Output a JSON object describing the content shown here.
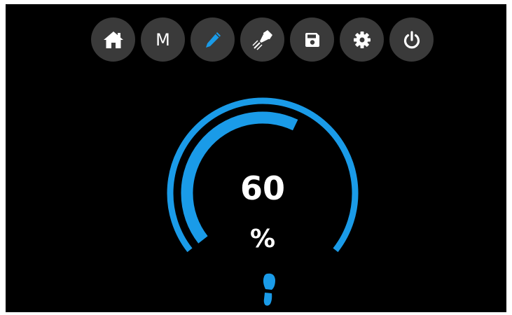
{
  "toolbar": {
    "buttons": [
      {
        "icon": "home-icon"
      },
      {
        "icon": "manual-mode",
        "label": "M"
      },
      {
        "icon": "pencil-icon",
        "active": true
      },
      {
        "icon": "glue-gun-icon"
      },
      {
        "icon": "save-icon"
      },
      {
        "icon": "gear-icon"
      },
      {
        "icon": "power-icon"
      }
    ],
    "button_color": "#3a3a3a",
    "icon_color": "#ffffff",
    "active_icon_color": "#1a9be8"
  },
  "gauge": {
    "value": "60",
    "unit": "%",
    "fraction": 0.6,
    "color": "#1a9be8"
  },
  "footer": {
    "icon": "foot-icon"
  },
  "colors": {
    "background": "#000000",
    "accent": "#1a9be8"
  }
}
